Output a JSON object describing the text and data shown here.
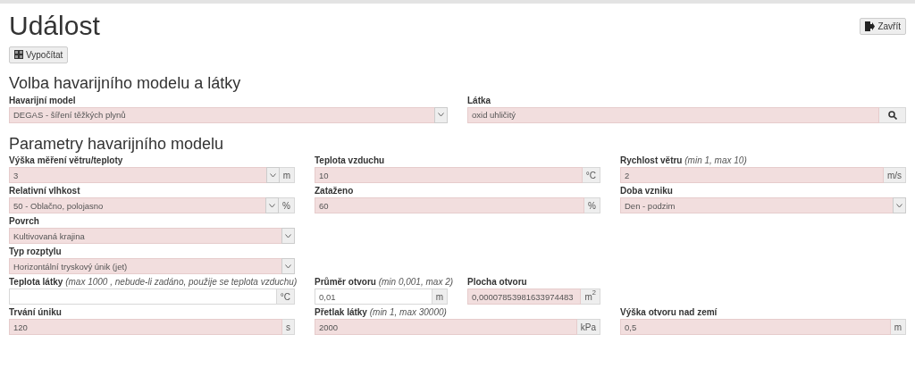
{
  "title": "Událost",
  "close_button": "Zavřít",
  "compute_button": "Vypočítat",
  "sections": [
    {
      "heading": "Volba havarijního modelu a látky",
      "rows": [
        [
          {
            "kind": "select",
            "label": "Havarijní model",
            "value": "DEGAS - šíření těžkých plynů",
            "invalid": true
          },
          {
            "kind": "search",
            "label": "Látka",
            "value": "oxid uhličitý",
            "invalid": true
          }
        ]
      ]
    },
    {
      "heading": "Parametry havarijního modelu",
      "rows": [
        [
          {
            "kind": "select",
            "label": "Výška měření větru/teploty",
            "value": "3",
            "unit": "m",
            "invalid": true
          },
          {
            "kind": "input",
            "label": "Teplota vzduchu",
            "value": "10",
            "unit": "°C",
            "invalid": true
          },
          {
            "kind": "input",
            "label": "Rychlost větru",
            "hint": "(min 1, max 10)",
            "value": "2",
            "unit": "m/s",
            "invalid": true
          }
        ],
        [
          {
            "kind": "select",
            "label": "Relativní vlhkost",
            "value": "50 - Oblačno, polojasno",
            "unit": "%",
            "invalid": true
          },
          {
            "kind": "input",
            "label": "Zataženo",
            "value": "60",
            "unit": "%",
            "invalid": true
          },
          {
            "kind": "select",
            "label": "Doba vzniku",
            "value": "Den - podzim",
            "invalid": true
          }
        ],
        [
          {
            "kind": "select",
            "label": "Povrch",
            "value": "Kultivovaná krajina",
            "invalid": true
          }
        ],
        [
          {
            "kind": "select",
            "label": "Typ rozptylu",
            "value": "Horizontální tryskový únik (jet)",
            "invalid": true
          }
        ],
        [
          {
            "kind": "input",
            "label": "Teplota látky",
            "hint": "(max 1000 , nebude-li zadáno, použije se teplota vzduchu)",
            "unit": "°C",
            "invalid": false
          },
          {
            "kind": "pair",
            "fields": [
              {
                "kind": "input",
                "label": "Průměr otvoru",
                "hint": "(min 0,001, max 2)",
                "value": "0,01",
                "unit": "m",
                "invalid": false
              },
              {
                "kind": "input",
                "label": "Plocha otvoru",
                "value": "0,00007853981633974483",
                "unit": "m$^{2}$",
                "invalid": true
              }
            ]
          }
        ],
        [
          {
            "kind": "input",
            "label": "Trvání úniku",
            "value": "120",
            "unit": "s",
            "invalid": true
          },
          {
            "kind": "input",
            "label": "Přetlak látky",
            "hint": "(min 1, max 30000)",
            "value": "2000",
            "unit": "kPa",
            "invalid": true
          },
          {
            "kind": "input",
            "label": "Výška otvoru nad zemí",
            "value": "0,5",
            "unit": "m",
            "invalid": true
          }
        ]
      ]
    }
  ]
}
